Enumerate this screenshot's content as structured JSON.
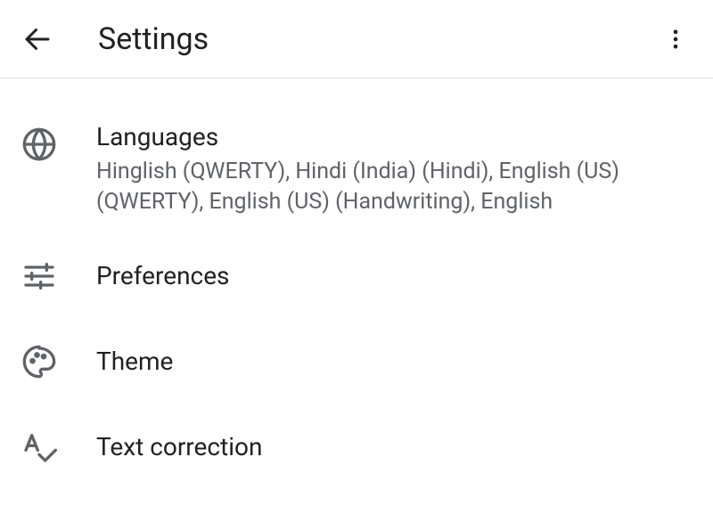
{
  "header": {
    "title": "Settings"
  },
  "items": [
    {
      "title": "Languages",
      "subtitle": "Hinglish (QWERTY), Hindi (India) (Hindi), English (US) (QWERTY), English (US) (Handwriting), English"
    },
    {
      "title": "Preferences"
    },
    {
      "title": "Theme"
    },
    {
      "title": "Text correction"
    }
  ]
}
